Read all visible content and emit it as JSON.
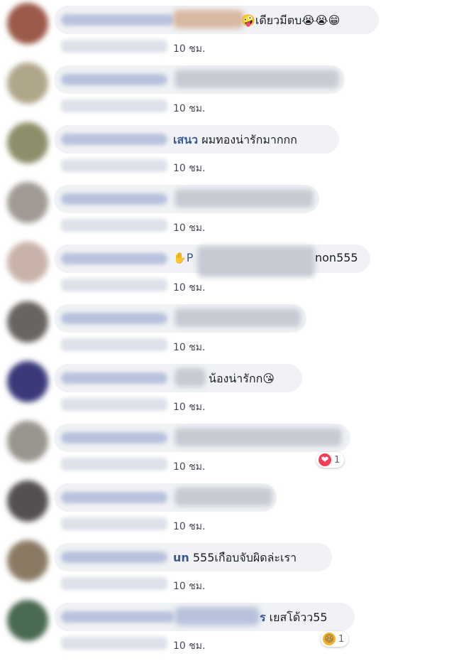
{
  "comments": [
    {
      "text": "🤪เดียวมีตบ😭😭😁",
      "time": "10 ชม."
    },
    {
      "text": "",
      "time": "10 ชม."
    },
    {
      "name_part": "เสนว",
      "text": " ผมทองน่ารักมากกก",
      "time": "10 ชม."
    },
    {
      "text": "",
      "time": "10 ชม."
    },
    {
      "name_part": "P",
      "text": "non555",
      "time": "10 ชม."
    },
    {
      "text": "",
      "time": "10 ชม."
    },
    {
      "text": "น้องน่ารักก😘",
      "time": "10 ชม."
    },
    {
      "text": "",
      "time": "10 ชม.",
      "reaction": {
        "icon": "❤",
        "count": "1"
      }
    },
    {
      "text": "",
      "time": "10 ชม."
    },
    {
      "name_part": "un",
      "text": " 555เกือบจับผิดล่ะเรา",
      "time": "10 ชม."
    },
    {
      "name_part": "ร",
      "text": " เยสโด้วว55",
      "time": "10 ชม.",
      "reaction": {
        "icon": "😆",
        "count": "1"
      }
    }
  ],
  "colors": {
    "bubble": "#f0f2f5",
    "name": "#385898",
    "love": "#f33e58",
    "haha": "#f7b125"
  }
}
